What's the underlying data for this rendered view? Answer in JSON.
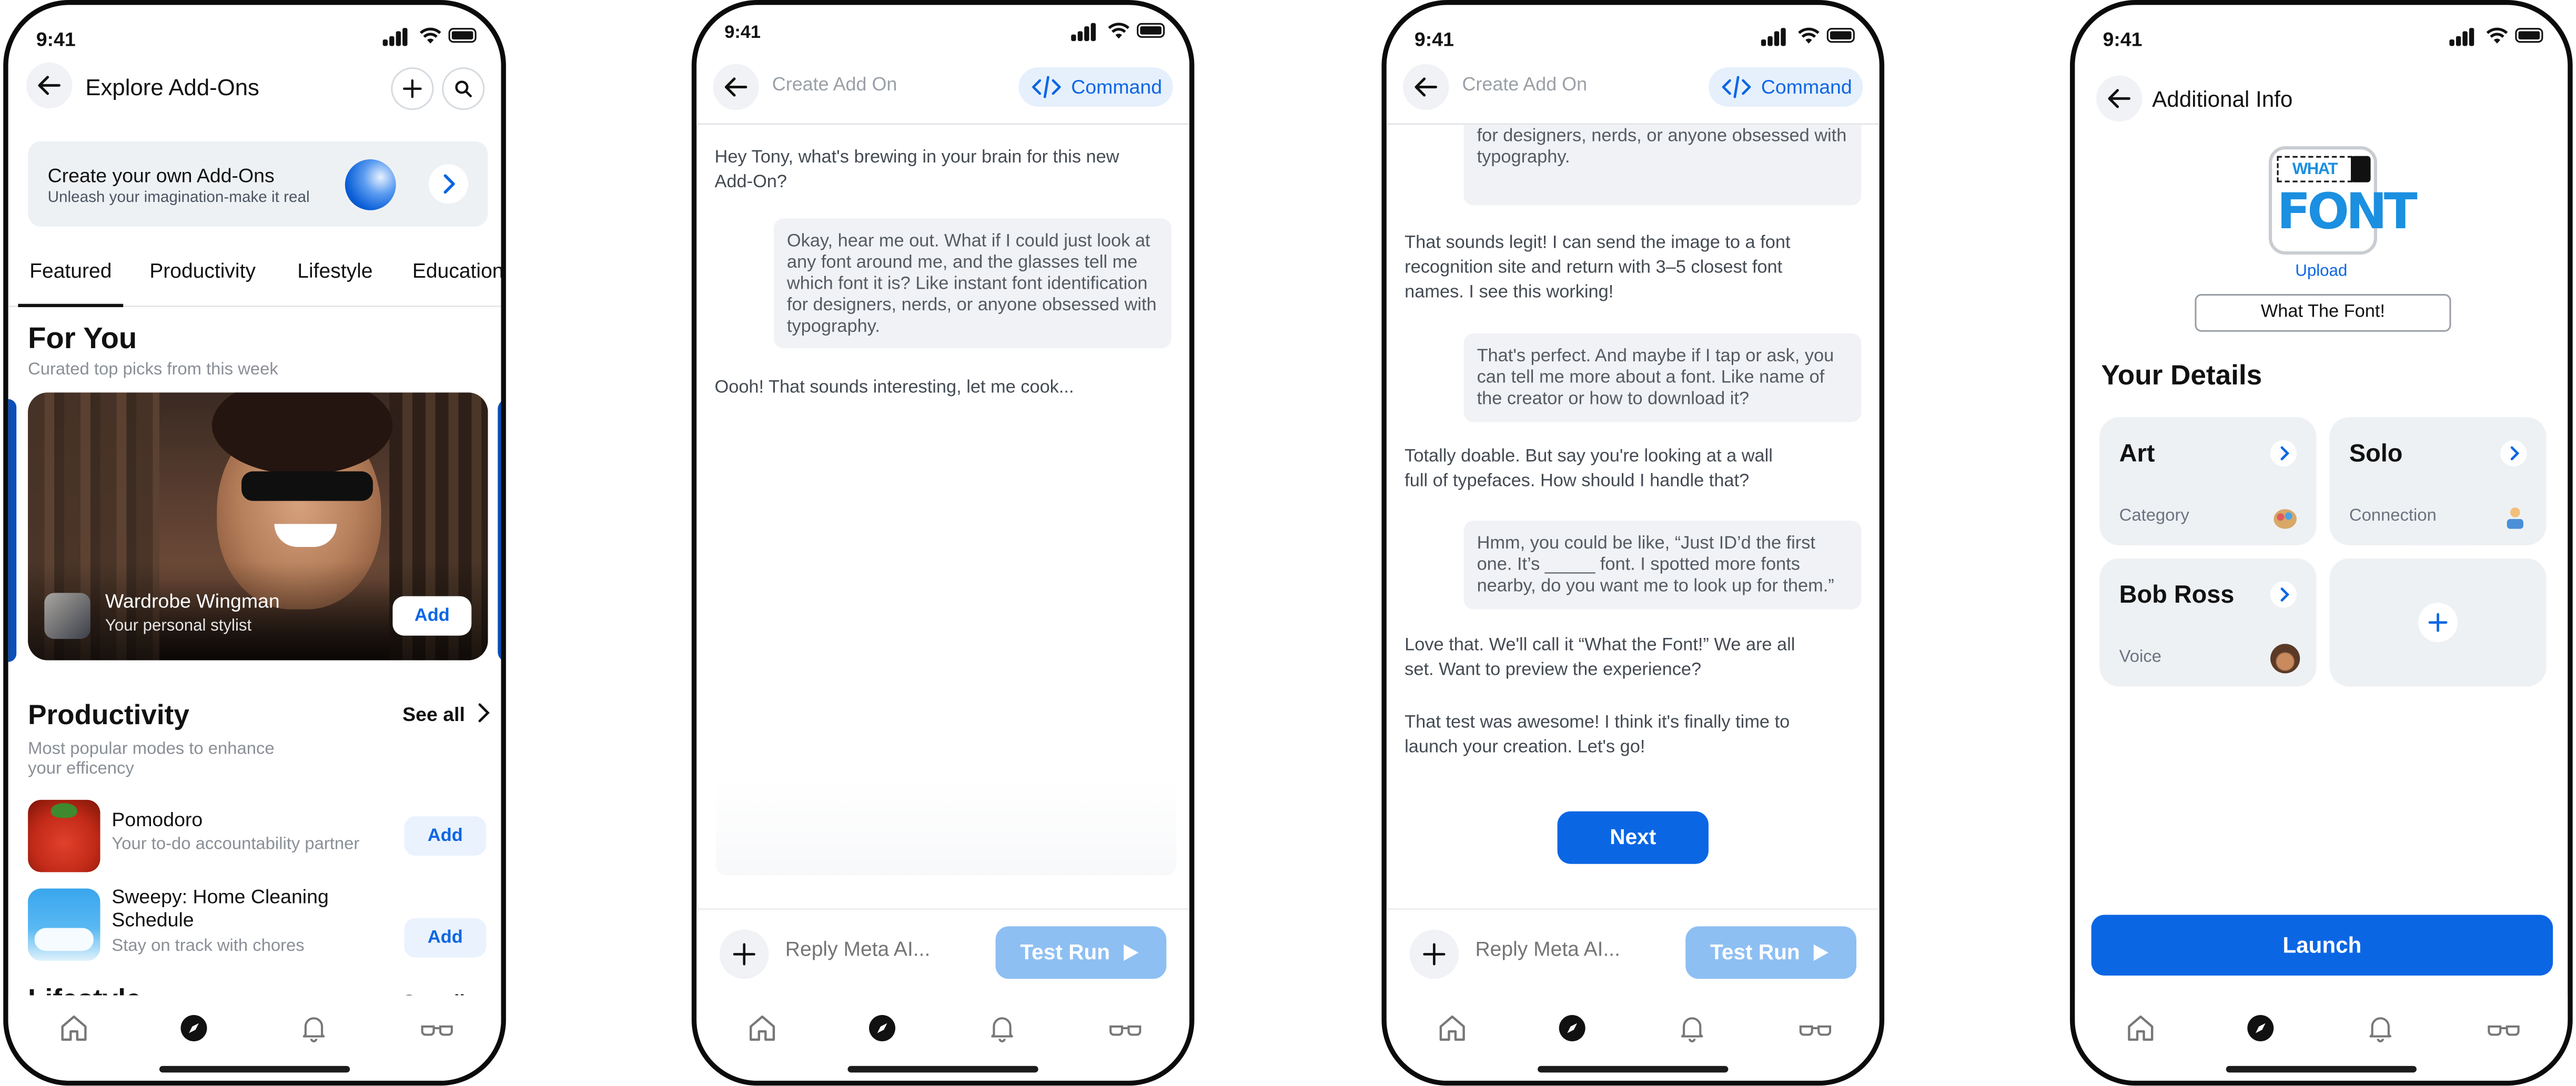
{
  "status_time": "9:41",
  "colors": {
    "accent": "#0B66E4",
    "muted": "#6B7280",
    "pill": "#E6F0FC"
  },
  "nav_icons": [
    "home-icon",
    "explore-icon",
    "bell-icon",
    "glasses-icon"
  ],
  "screen1": {
    "title": "Explore Add-Ons",
    "banner": {
      "title": "Create your own Add-Ons",
      "subtitle": "Unleash your imagination-make it real"
    },
    "tabs": [
      "Featured",
      "Productivity",
      "Lifestyle",
      "Education"
    ],
    "active_tab": "Featured",
    "for_you": {
      "title": "For You",
      "subtitle": "Curated top picks from this week"
    },
    "hero": {
      "name": "Wardrobe Wingman",
      "desc": "Your personal stylist",
      "button": "Add"
    },
    "productivity": {
      "title": "Productivity",
      "see_all": "See all",
      "subtitle": "Most popular modes to enhance your efficency",
      "items": [
        {
          "name": "Pomodoro",
          "desc": "Your to-do accountability partner",
          "button": "Add"
        },
        {
          "name": "Sweepy: Home Cleaning Schedule",
          "desc": "Stay on track with chores",
          "button": "Add"
        }
      ]
    },
    "next_section_partial": "Lifestyle",
    "next_see_all_partial": "See all"
  },
  "screen2": {
    "header": "Create Add On",
    "command": "Command",
    "messages": [
      {
        "role": "ai",
        "text": "Hey Tony, what's brewing in your brain for this new Add-On?"
      },
      {
        "role": "user",
        "text": "Okay, hear me out. What if I could just look at any font around me, and the glasses tell me which font it is? Like instant font identification for designers, nerds, or anyone obsessed with typography."
      },
      {
        "role": "ai",
        "text": "Oooh! That sounds interesting, let me cook..."
      }
    ],
    "composer": {
      "placeholder": "Reply Meta AI...",
      "button": "Test Run"
    }
  },
  "screen3": {
    "header": "Create Add On",
    "command": "Command",
    "partial_user": "at any font around me, and the glasses tell me which font it is? Like instant font identification for designers, nerds, or anyone obsessed with typography.",
    "messages": [
      {
        "role": "ai",
        "text": "That sounds legit! I can send the image to a font recognition site and return with 3–5 closest font names. I see this working!"
      },
      {
        "role": "user",
        "text": "That's perfect. And maybe if I tap or ask, you can tell me more about a font. Like name of the creator or how to download it?"
      },
      {
        "role": "ai",
        "text": "Totally doable. But say you're looking at a wall full of typefaces. How should I handle that?"
      },
      {
        "role": "user",
        "text": "Hmm, you could be like, “Just ID’d the first one. It’s _____ font. I spotted more fonts nearby, do you want me to look up for them.”"
      },
      {
        "role": "ai",
        "text": "Love that. We'll call it “What the Font!” We are all set. Want to preview the experience?"
      },
      {
        "role": "ai",
        "text": "That test was awesome! I think it's finally time to launch your creation. Let's go!"
      }
    ],
    "next_button": "Next",
    "composer": {
      "placeholder": "Reply Meta AI...",
      "button": "Test Run"
    }
  },
  "screen4": {
    "title": "Additional Info",
    "logo_text": "WHAT FONT",
    "upload": "Upload",
    "name_value": "What The Font!",
    "details_title": "Your Details",
    "cards": [
      {
        "title": "Art",
        "sub": "Category",
        "icon": "palette-icon"
      },
      {
        "title": "Solo",
        "sub": "Connection",
        "icon": "person-icon"
      },
      {
        "title": "Bob Ross",
        "sub": "Voice",
        "icon": "avatar-icon"
      }
    ],
    "launch": "Launch"
  }
}
